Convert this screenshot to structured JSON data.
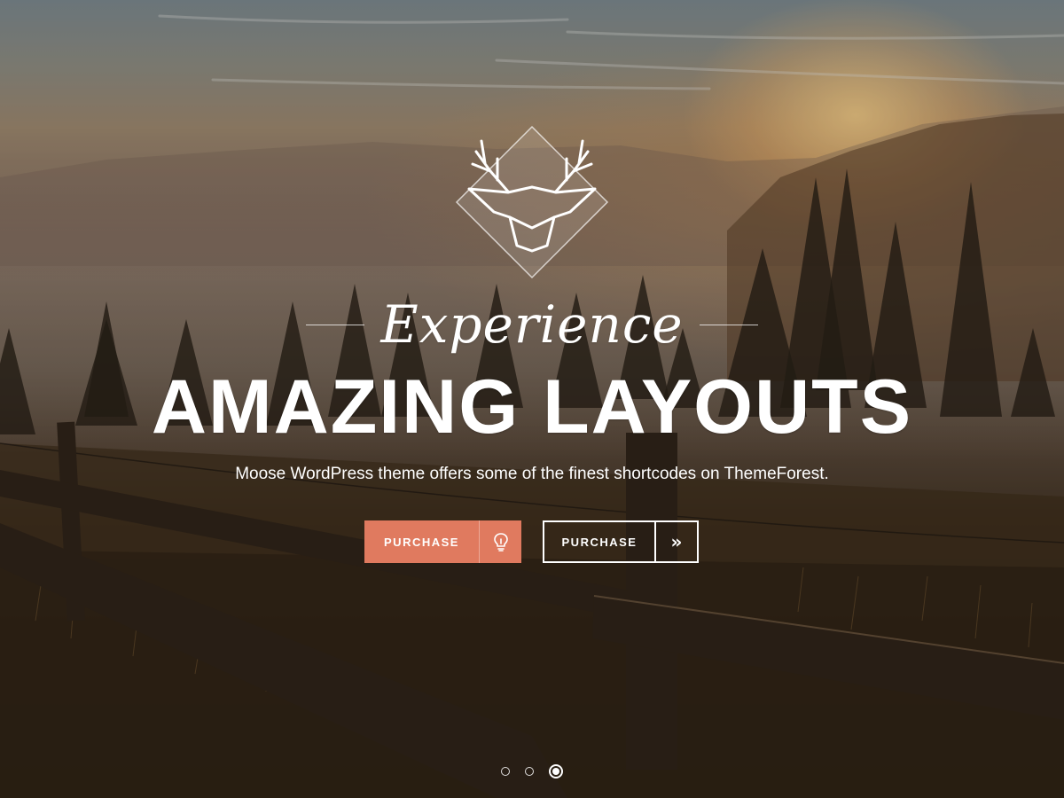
{
  "hero": {
    "kicker": "Experience",
    "headline": "AMAZING LAYOUTS",
    "subtitle": "Moose WordPress theme offers some of the finest shortcodes on ThemeForest.",
    "logo_icon": "deer-head-icon",
    "background": "misty-forest-sunrise-with-wooden-fence"
  },
  "buttons": {
    "primary": {
      "label": "PURCHASE",
      "icon": "lightbulb-icon",
      "color": "#e07a5f"
    },
    "secondary": {
      "label": "PURCHASE",
      "icon": "double-chevron-right-icon",
      "glyph": "»",
      "color": "#ffffff"
    }
  },
  "slider": {
    "slide_count": 3,
    "active_slide": 3
  },
  "colors": {
    "accent": "#e07a5f",
    "text": "#ffffff"
  }
}
